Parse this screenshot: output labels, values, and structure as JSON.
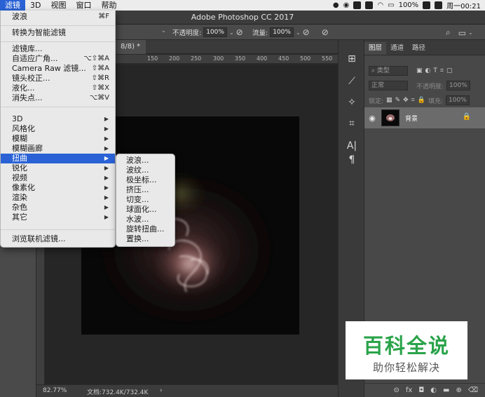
{
  "menubar": {
    "items": [
      "滤镜",
      "3D",
      "视图",
      "窗口",
      "帮助"
    ],
    "active_index": 0,
    "battery": "100%",
    "clock": "周一00:21"
  },
  "window": {
    "title": "Adobe Photoshop CC 2017"
  },
  "options": {
    "opacity_label": "不透明度:",
    "opacity_value": "100%",
    "flow_label": "流量:",
    "flow_value": "100%"
  },
  "document": {
    "tab_label": "8/8) *",
    "ruler_ticks": [
      "150",
      "200",
      "250",
      "300",
      "350",
      "400",
      "450",
      "500",
      "550"
    ],
    "zoom": "82.77%",
    "doc_size": "文档:732.4K/732.4K"
  },
  "layers_panel": {
    "tabs": [
      "图层",
      "通道",
      "路径"
    ],
    "active_tab": 0,
    "filter_kind": "类型",
    "blend_mode": "正常",
    "opacity_label": "不透明度:",
    "opacity_value": "100%",
    "lock_label": "锁定:",
    "fill_label": "填充:",
    "fill_value": "100%",
    "layer_name": "背景"
  },
  "filter_menu": {
    "groups": [
      [
        {
          "label": "波浪",
          "shortcut": "⌘F"
        }
      ],
      [
        {
          "label": "转换为智能滤镜"
        }
      ],
      [
        {
          "label": "滤镜库..."
        },
        {
          "label": "自适应广角...",
          "shortcut": "⌥⇧⌘A"
        },
        {
          "label": "Camera Raw 滤镜...",
          "shortcut": "⇧⌘A"
        },
        {
          "label": "镜头校正...",
          "shortcut": "⇧⌘R"
        },
        {
          "label": "液化...",
          "shortcut": "⇧⌘X"
        },
        {
          "label": "消失点...",
          "shortcut": "⌥⌘V"
        }
      ],
      [
        {
          "label": "3D",
          "submenu": true
        },
        {
          "label": "风格化",
          "submenu": true
        },
        {
          "label": "模糊",
          "submenu": true
        },
        {
          "label": "模糊画廊",
          "submenu": true
        },
        {
          "label": "扭曲",
          "submenu": true,
          "highlighted": true
        },
        {
          "label": "锐化",
          "submenu": true
        },
        {
          "label": "视频",
          "submenu": true
        },
        {
          "label": "像素化",
          "submenu": true
        },
        {
          "label": "渲染",
          "submenu": true
        },
        {
          "label": "杂色",
          "submenu": true
        },
        {
          "label": "其它",
          "submenu": true
        }
      ],
      [
        {
          "label": "浏览联机滤镜..."
        }
      ]
    ]
  },
  "distort_submenu": {
    "items": [
      "波浪...",
      "波纹...",
      "极坐标...",
      "挤压...",
      "切变...",
      "球面化...",
      "水波...",
      "旋转扭曲...",
      "置换..."
    ]
  },
  "watermark": {
    "title": "百科全说",
    "subtitle": "助你轻松解决"
  },
  "colors": {
    "highlight": "#2a62d6",
    "watermark_green": "#2aa34a"
  }
}
